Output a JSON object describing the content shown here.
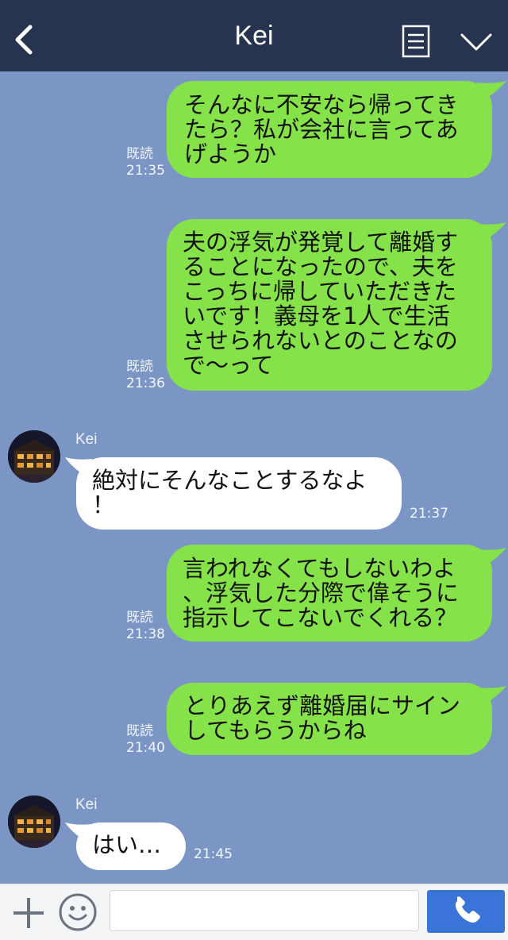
{
  "header": {
    "title": "Kei"
  },
  "messages": [
    {
      "from": "me",
      "text": "そんなに不安なら帰ってき\nたら？私が会社に言ってあ\nげようか",
      "read": "既読",
      "time": "21:35"
    },
    {
      "from": "me",
      "text": "夫の浮気が発覚して離婚す\nることになったので、夫を\nこっちに帰していただきた\nいです！義母を1人で生活\nさせられないとのことなの\nで〜って",
      "read": "既読",
      "time": "21:36"
    },
    {
      "from": "them",
      "sender": "Kei",
      "text": "絶対にそんなことするなよ\n！",
      "time": "21:37"
    },
    {
      "from": "me",
      "text": "言われなくてもしないわよ\n、浮気した分際で偉そうに\n指示してこないでくれる？",
      "read": "既読",
      "time": "21:38"
    },
    {
      "from": "me",
      "text": "とりあえず離婚届にサイン\nしてもらうからね",
      "read": "既読",
      "time": "21:40"
    },
    {
      "from": "them",
      "sender": "Kei",
      "text": "はい…",
      "time": "21:45"
    }
  ],
  "input": {
    "value": "",
    "placeholder": ""
  },
  "colors": {
    "background": "#7b96c4",
    "header": "#273450",
    "my_bubble": "#85e249",
    "their_bubble": "#ffffff",
    "call_button": "#3b74d8"
  },
  "icons": {
    "back": "chevron-left-icon",
    "menu": "document-menu-icon",
    "collapse": "chevron-down-icon",
    "add": "plus-icon",
    "emoji": "smiley-icon",
    "call": "phone-icon"
  }
}
